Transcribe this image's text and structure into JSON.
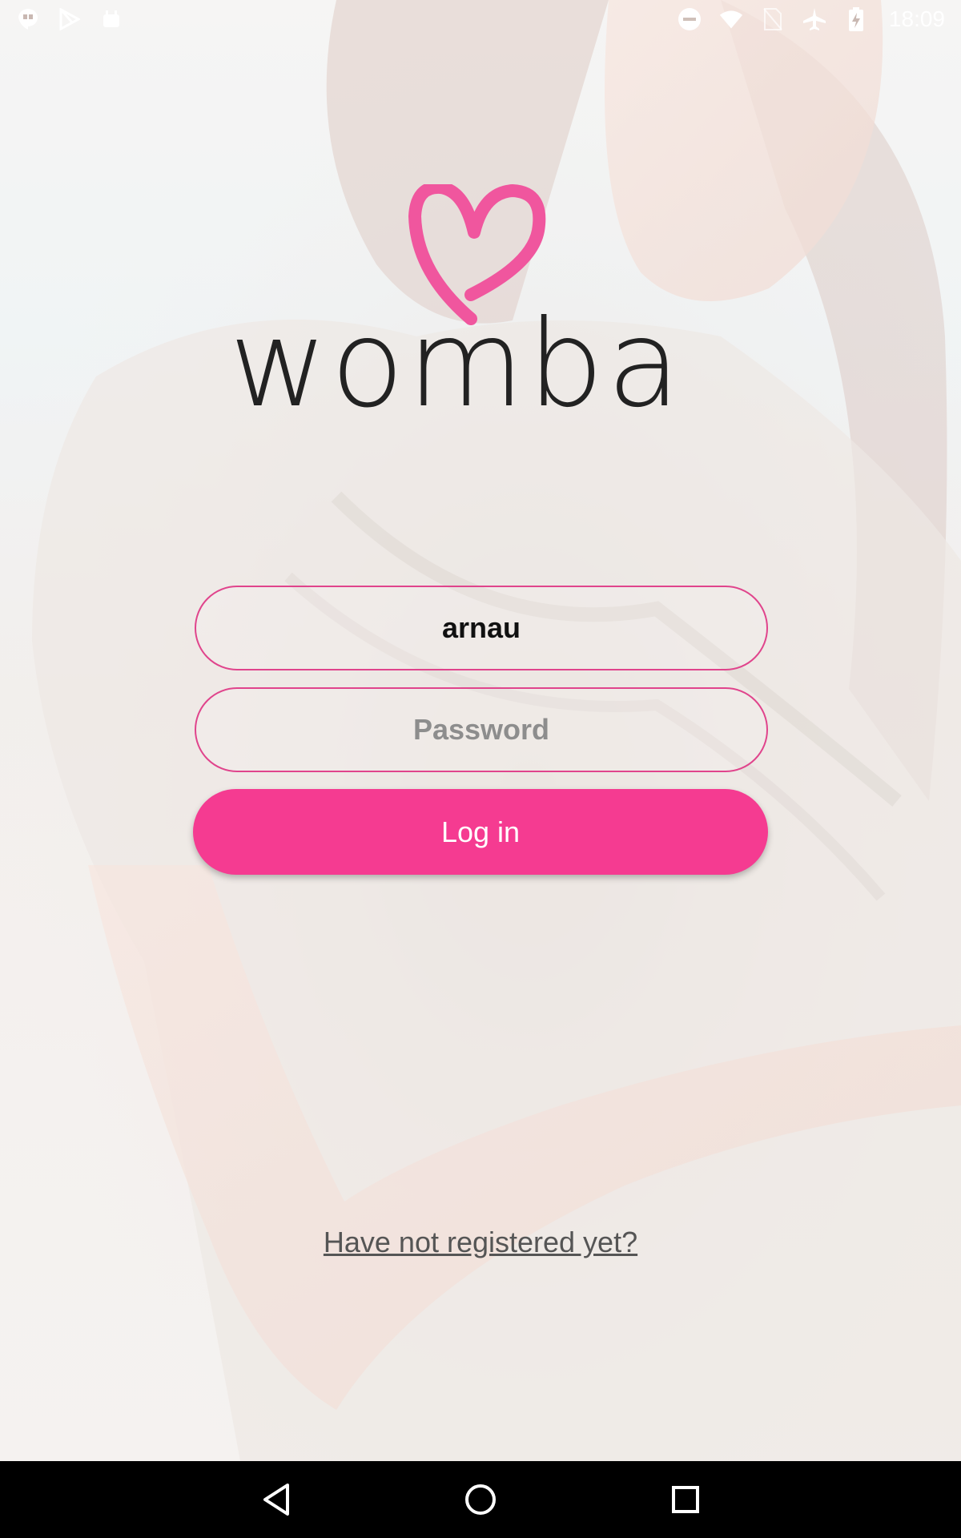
{
  "status_bar": {
    "time": "18:09",
    "left_icons": [
      "hangouts-icon",
      "play-store-icon",
      "android-icon"
    ],
    "right_icons": [
      "do-not-disturb-icon",
      "wifi-icon",
      "no-sim-icon",
      "airplane-mode-icon",
      "battery-charging-icon"
    ]
  },
  "logo": {
    "text": "womba",
    "heart_color": "#f0569e"
  },
  "login_form": {
    "username_value": "arnau",
    "password_placeholder": "Password",
    "login_label": "Log in",
    "register_link": "Have not registered yet?"
  },
  "nav_bar": {
    "icons": [
      "back-icon",
      "home-icon",
      "recents-icon"
    ]
  },
  "colors": {
    "accent": "#f53b91",
    "field_border": "#e0448c"
  }
}
